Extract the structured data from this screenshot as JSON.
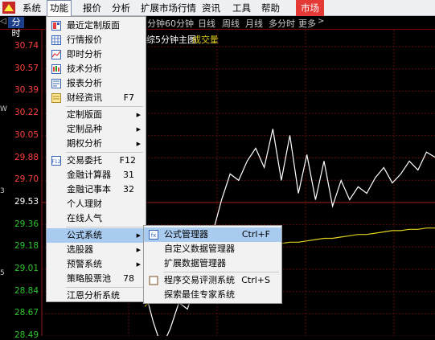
{
  "menubar": {
    "items": [
      "系统",
      "功能",
      "报价",
      "分析",
      "扩展市场行情",
      "资讯",
      "工具",
      "帮助"
    ],
    "market": "市场"
  },
  "toolbar": {
    "first": "分时",
    "items": [
      "分钟",
      "60分钟",
      "日线",
      "周线",
      "月线",
      "多分时",
      "更多"
    ]
  },
  "chart_header": {
    "title_fragment": "综5分钟主图",
    "indicator": "成交量"
  },
  "y_axis": {
    "ticks": [
      "30.74",
      "30.57",
      "30.39",
      "30.22",
      "30.05",
      "29.88",
      "29.70",
      "29.53",
      "29.36",
      "29.18",
      "29.01",
      "28.84",
      "28.67",
      "28.49"
    ]
  },
  "left_edge_marks": [
    "W",
    "3",
    "5"
  ],
  "chart_data": {
    "type": "line",
    "title": "",
    "xlabel": "",
    "ylabel": "",
    "ylim": [
      28.49,
      30.74
    ],
    "series": [
      {
        "color": "#ffffff",
        "values": [
          28.85,
          28.6,
          28.4,
          28.55,
          28.75,
          28.7,
          28.9,
          29.2,
          29.3,
          29.55,
          29.75,
          29.7,
          29.85,
          29.95,
          29.8,
          30.1,
          29.7,
          30.05,
          29.6,
          29.9,
          29.55,
          29.85,
          29.5,
          29.7,
          29.55,
          29.65,
          29.6,
          29.72,
          29.8,
          29.68,
          29.75,
          29.85,
          29.78,
          29.92,
          29.88
        ]
      },
      {
        "color": "#e0d020",
        "values": [
          28.72,
          28.78,
          28.84,
          28.9,
          28.95,
          29.0,
          29.05,
          29.08,
          29.1,
          29.12,
          29.13,
          29.15,
          29.16,
          29.17,
          29.18,
          29.2,
          29.21,
          29.22,
          29.22,
          29.23,
          29.24,
          29.25,
          29.25,
          29.26,
          29.27,
          29.28,
          29.28,
          29.29,
          29.3,
          29.31,
          29.31,
          29.32,
          29.32,
          29.33,
          29.33
        ]
      }
    ]
  },
  "colors": {
    "accent_red": "#e53935",
    "y_up": "#ff4040",
    "y_mid": "#ffffff",
    "y_down": "#2ec42e",
    "menu_highlight": "#aacbf0"
  },
  "function_menu": {
    "items": [
      {
        "label": "最近定制版面",
        "icon": "layout-icon"
      },
      {
        "label": "行情报价",
        "icon": "grid-icon"
      },
      {
        "label": "即时分析",
        "icon": "line-chart-icon"
      },
      {
        "label": "技术分析",
        "icon": "candlestick-icon"
      },
      {
        "label": "报表分析",
        "icon": "report-icon"
      },
      {
        "label": "财经资讯",
        "icon": "news-icon",
        "shortcut": "F7"
      },
      {
        "label": "定制版面",
        "arrow": true
      },
      {
        "label": "定制品种",
        "arrow": true
      },
      {
        "label": "期权分析",
        "arrow": true
      },
      {
        "label": "交易委托",
        "icon": "f12-icon",
        "shortcut": "F12"
      },
      {
        "label": "金融计算器",
        "shortcut": "31"
      },
      {
        "label": "金融记事本",
        "shortcut": "32"
      },
      {
        "label": "个人理财"
      },
      {
        "label": "在线人气"
      },
      {
        "label": "公式系统",
        "arrow": true,
        "highlighted": true
      },
      {
        "label": "选股器",
        "arrow": true
      },
      {
        "label": "预警系统",
        "arrow": true
      },
      {
        "label": "策略股票池",
        "shortcut": "78"
      },
      {
        "label": "江恩分析系统"
      }
    ]
  },
  "formula_submenu": {
    "items": [
      {
        "label": "公式管理器",
        "icon": "formula-icon",
        "shortcut": "Ctrl+F",
        "highlighted": true
      },
      {
        "label": "自定义数据管理器"
      },
      {
        "label": "扩展数据管理器"
      },
      {
        "label": "程序交易评测系统",
        "icon": "checkbox-icon",
        "shortcut": "Ctrl+S"
      },
      {
        "label": "探索最佳专家系统"
      }
    ]
  }
}
